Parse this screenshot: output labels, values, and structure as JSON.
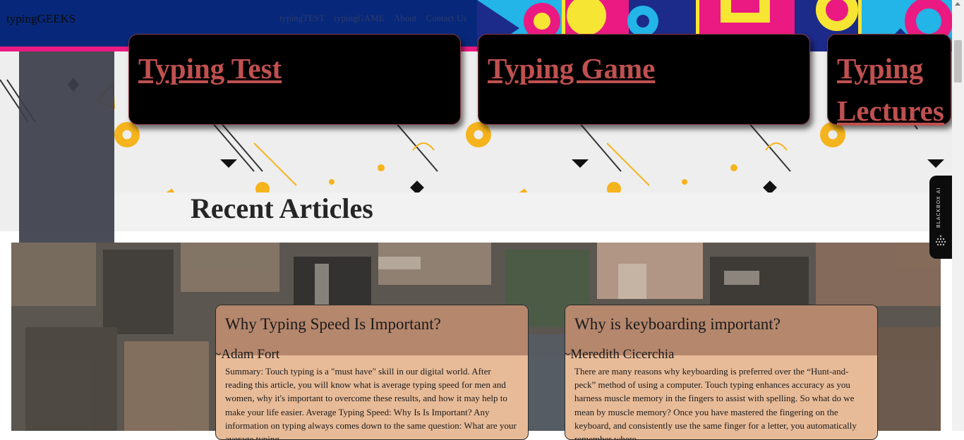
{
  "nav": {
    "brand": "typingGEEKS",
    "links": [
      "typingTEST",
      "typingGAME",
      "About",
      "Contact Us"
    ]
  },
  "cards": [
    {
      "label": "Typing Test"
    },
    {
      "label": "Typing Game"
    },
    {
      "label": "Typing Lectures"
    }
  ],
  "recent_title": "Recent Articles",
  "articles": [
    {
      "title": "Why Typing Speed Is Important?",
      "author": "~Adam Fort",
      "body": "Summary: Touch typing is a \"must have\" skill in our digital world. After reading this article, you will know what is average typing speed for men and women, why it's important to overcome these results, and how it may help to make your life easier. Average Typing Speed: Why Is Is Important? Any information on typing always comes down to the same question: What are your average typing"
    },
    {
      "title": "Why is keyboarding important?",
      "author": "~Meredith Cicerchia",
      "body": "There are many reasons why keyboarding is preferred over the “Hunt-and-peck” method of using a computer. Touch typing enhances accuracy as you harness muscle memory in the fingers to assist with spelling. So what do we mean by muscle memory? Once you have mastered the fingering on the keyboard, and consistently use the same finger for a letter, you automatically remember where"
    }
  ],
  "side_tab": "BLACKBOX AI",
  "colors": {
    "navbar": "#07287a",
    "accent": "#ea1a82",
    "card_link": "#c05050",
    "article_header": "#b5876d",
    "article_body": "#e8bb98"
  }
}
